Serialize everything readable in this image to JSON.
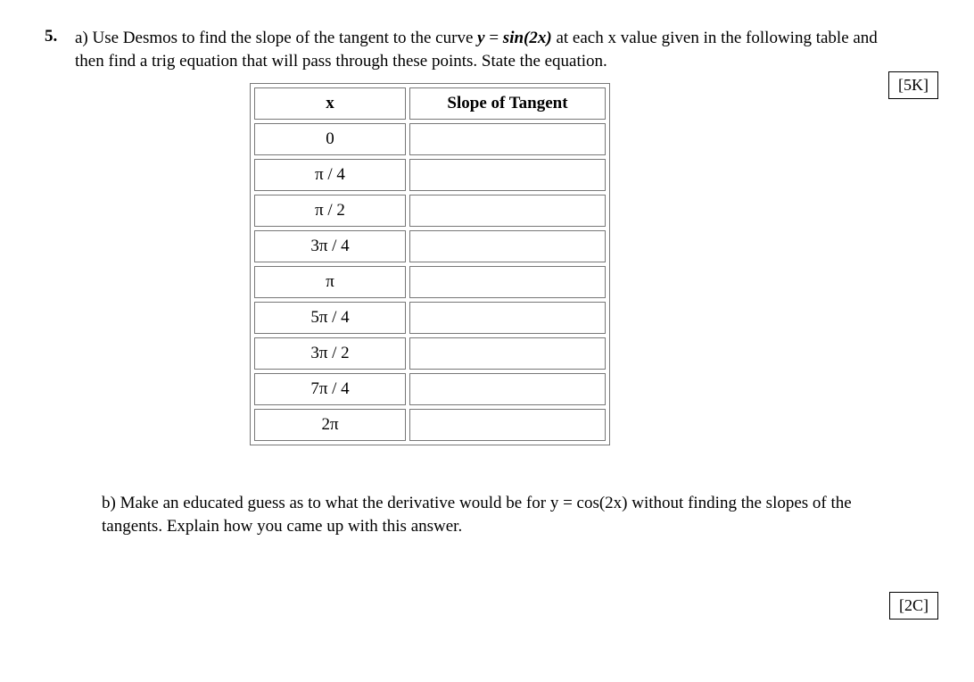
{
  "question": {
    "number": "5.",
    "part_a_prefix": "a) Use Desmos to find the slope of the tangent to the curve ",
    "part_a_eq_lhs": "y",
    "part_a_eq_eq": " = ",
    "part_a_eq_rhs": "sin(2x)",
    "part_a_suffix": "  at each x value given in the following table and then find a trig equation that will pass through these points. State the equation.",
    "part_b_prefix": "b) Make an educated guess as to what the derivative would be for ",
    "part_b_eq_lhs": "y",
    "part_b_eq_eq": " = ",
    "part_b_eq_rhs": "cos(2x)",
    "part_b_suffix": " without finding the slopes of the tangents. Explain how you came up with this answer."
  },
  "marks": {
    "a": "[5K]",
    "b": "[2C]"
  },
  "table": {
    "headers": {
      "x": "x",
      "slope": "Slope of Tangent"
    },
    "rows": [
      {
        "x": "0",
        "slope": ""
      },
      {
        "x": "π / 4",
        "slope": ""
      },
      {
        "x": "π / 2",
        "slope": ""
      },
      {
        "x": "3π / 4",
        "slope": ""
      },
      {
        "x": "π",
        "slope": ""
      },
      {
        "x": "5π / 4",
        "slope": ""
      },
      {
        "x": "3π / 2",
        "slope": ""
      },
      {
        "x": "7π / 4",
        "slope": ""
      },
      {
        "x": "2π",
        "slope": ""
      }
    ]
  }
}
